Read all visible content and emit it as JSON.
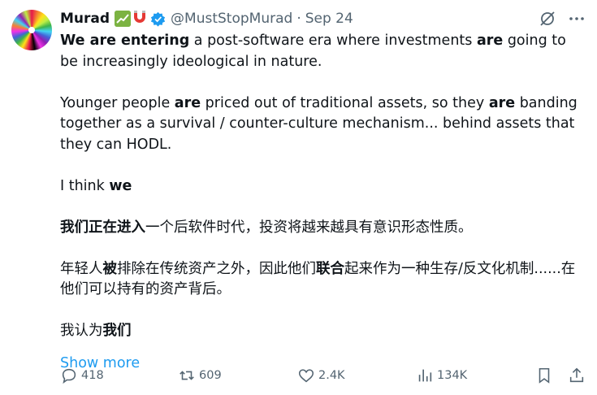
{
  "author": {
    "name": "Murad",
    "handle": "@MustStopMurad",
    "separator": "·",
    "date": "Sep 24"
  },
  "body": {
    "p1": {
      "b1": "We are entering",
      "t1": " a post-software era where investments ",
      "b2": "are",
      "t2": " going to be increasingly ideological in nature."
    },
    "p2": {
      "t1": "Younger people ",
      "b1": "are",
      "t2": " priced out of traditional assets, so they ",
      "b2": "are",
      "t3": " banding together as a survival / counter-culture mechanism... behind assets that they can HODL."
    },
    "p3": {
      "t1": "I think ",
      "b1": "we"
    },
    "p4": {
      "b1": "我们正在进入",
      "t1": "一个后软件时代，投资将越来越具有意识形态性质。"
    },
    "p5": {
      "t1": "年轻人",
      "b1": "被",
      "t2": "排除在传统资产之外，因此他们",
      "b2": "联合",
      "t3": "起来作为一种生存/反文化机制......在他们可以持有的资产背后。"
    },
    "p6": {
      "t1": "我认为",
      "b1": "我们"
    },
    "show_more": "Show more"
  },
  "actions": {
    "replies": "418",
    "reposts": "609",
    "likes": "2.4K",
    "views": "134K"
  },
  "colors": {
    "text": "#0f1419",
    "muted": "#536471",
    "link": "#1d9bf0",
    "verified": "#1d9bf0"
  }
}
